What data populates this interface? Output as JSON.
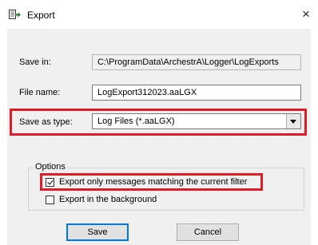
{
  "window": {
    "title": "Export",
    "close_glyph": "×"
  },
  "form": {
    "save_in_label": "Save in:",
    "save_in_value": "C:\\ProgramData\\ArchestrA\\Logger\\LogExports",
    "file_name_label": "File name:",
    "file_name_value": "LogExport312023.aaLGX",
    "save_as_type_label": "Save as type:",
    "save_as_type_value": "Log Files (*.aaLGX)"
  },
  "options": {
    "group_title": "Options",
    "export_filtered_label": "Export only messages matching the current filter",
    "export_filtered_checked": true,
    "export_background_label": "Export in the background",
    "export_background_checked": false
  },
  "buttons": {
    "save_label": "Save",
    "cancel_label": "Cancel"
  },
  "colors": {
    "highlight": "#e01b2a",
    "dialog_bg": "#f0f0f0",
    "default_button_border": "#0078d7"
  }
}
